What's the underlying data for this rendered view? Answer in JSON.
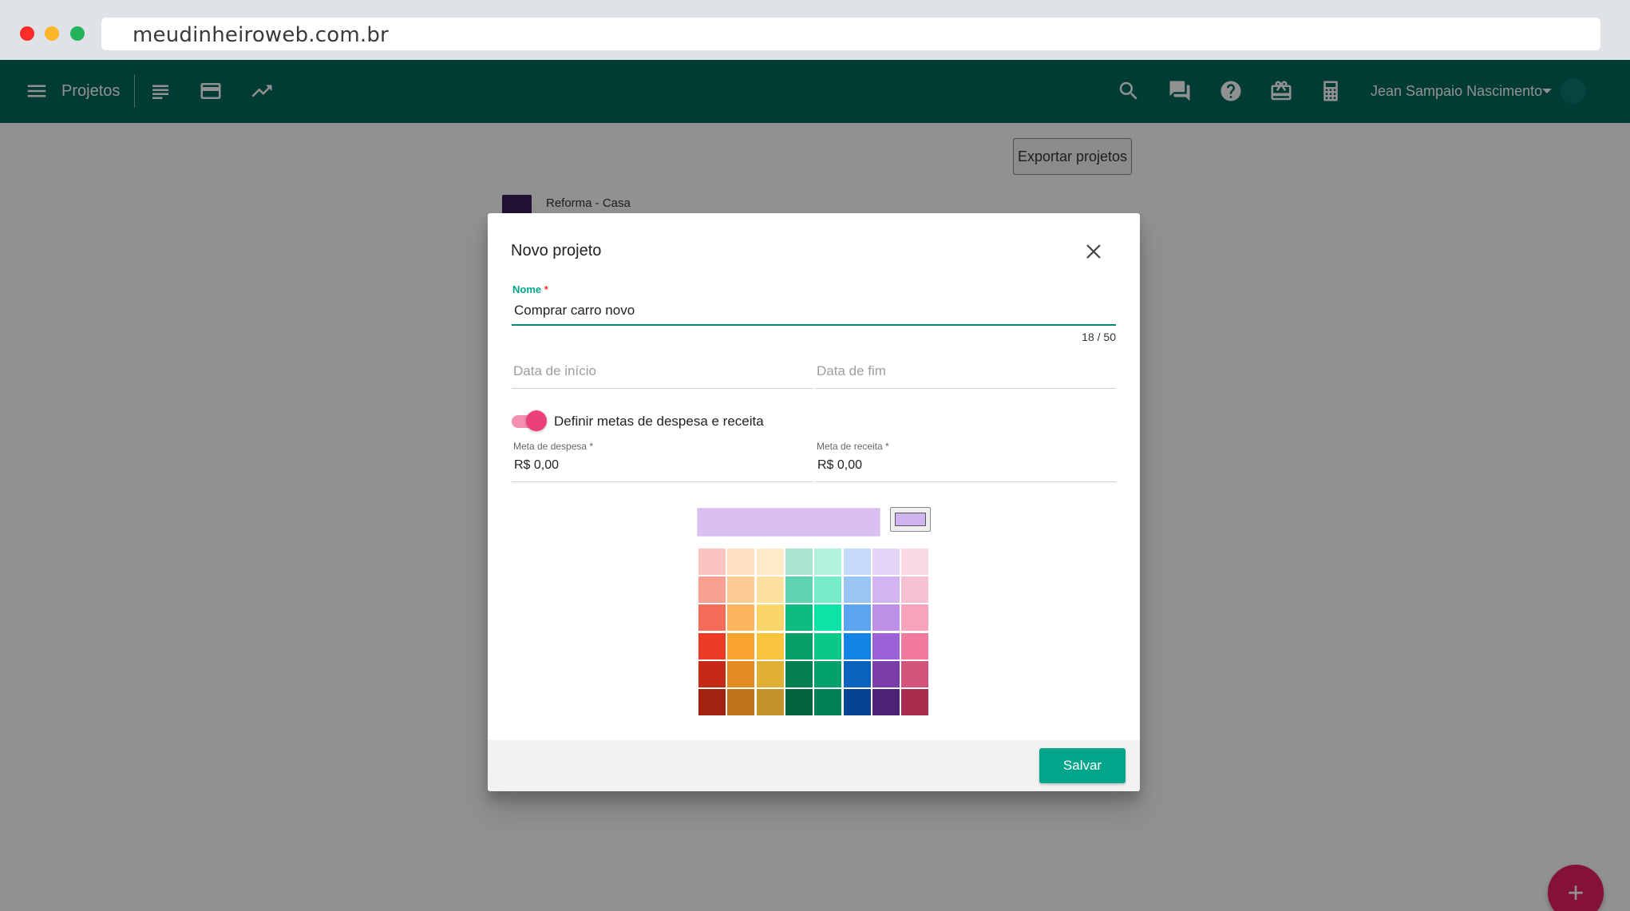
{
  "browser": {
    "url": "meudinheiroweb.com.br"
  },
  "app_bar": {
    "section_title": "Projetos",
    "nav_icons": [
      "menu-icon",
      "list-icon",
      "card-icon",
      "trending-up-icon"
    ],
    "action_icons": [
      "search-icon",
      "chat-icon",
      "help-icon",
      "gift-card-icon",
      "calculator-icon"
    ],
    "user_name": "Jean Sampaio Nascimento"
  },
  "page": {
    "export_label": "Exportar projetos",
    "projects": [
      {
        "name": "Reforma - Casa",
        "color": "#3b1f5a"
      }
    ],
    "fab_label": "+"
  },
  "dialog": {
    "title": "Novo projeto",
    "name_field": {
      "label": "Nome",
      "required_mark": "*",
      "value": "Comprar carro novo",
      "counter": "18 / 50"
    },
    "start_date_placeholder": "Data de início",
    "end_date_placeholder": "Data de fim",
    "goals_toggle": {
      "label": "Definir metas de despesa e receita",
      "on": true
    },
    "expense_goal": {
      "label": "Meta de despesa *",
      "value": "R$ 0,00"
    },
    "income_goal": {
      "label": "Meta de receita *",
      "value": "R$ 0,00"
    },
    "selected_color": "#d9c0f0",
    "palette": [
      [
        "#fbc4c0",
        "#fde0c2",
        "#fdebc8",
        "#a8e4d0",
        "#b0f2de",
        "#c4daf8",
        "#e4d4f5",
        "#fbd9e4"
      ],
      [
        "#f9a092",
        "#fccb96",
        "#fde19e",
        "#5fd3b1",
        "#76ecc8",
        "#99c4f3",
        "#d2b4f0",
        "#f8c0d3"
      ],
      [
        "#f56c58",
        "#fbb65f",
        "#fbd46c",
        "#0ebc82",
        "#0de3a6",
        "#5ba4ef",
        "#bd91e7",
        "#f6a3bc"
      ],
      [
        "#ec3b26",
        "#f9a32f",
        "#f9c53f",
        "#069e67",
        "#08c88a",
        "#1383e6",
        "#9c61d6",
        "#f27a9c"
      ],
      [
        "#c42a16",
        "#e28c23",
        "#e0b036",
        "#047f52",
        "#04a06c",
        "#0962bd",
        "#7b3da7",
        "#d15479"
      ],
      [
        "#a3210f",
        "#c0731b",
        "#c2942b",
        "#026540",
        "#037f56",
        "#064493",
        "#4c2377",
        "#a72c4d"
      ]
    ],
    "save_label": "Salvar"
  }
}
